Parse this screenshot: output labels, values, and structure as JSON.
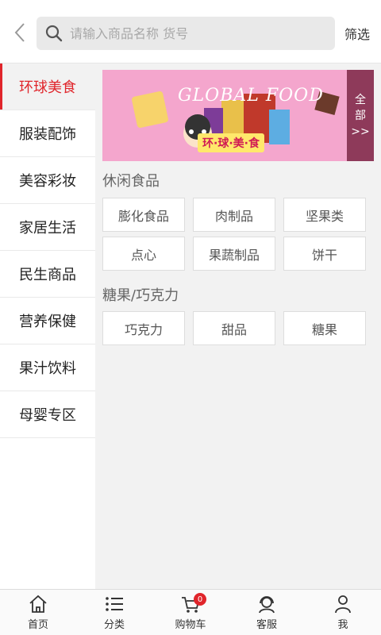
{
  "header": {
    "search_placeholder": "请输入商品名称 货号",
    "filter_label": "筛选"
  },
  "sidebar": {
    "items": [
      {
        "label": "环球美食"
      },
      {
        "label": "服装配饰"
      },
      {
        "label": "美容彩妆"
      },
      {
        "label": "家居生活"
      },
      {
        "label": "民生商品"
      },
      {
        "label": "营养保健"
      },
      {
        "label": "果汁饮料"
      },
      {
        "label": "母婴专区"
      }
    ]
  },
  "banner": {
    "title": "GLOBAL FOOD",
    "tag": "环·球·美·食",
    "all_line1": "全",
    "all_line2": "部",
    "all_arrow": ">>"
  },
  "sections": [
    {
      "title": "休闲食品",
      "items": [
        "膨化食品",
        "肉制品",
        "坚果类",
        "点心",
        "果蔬制品",
        "饼干"
      ]
    },
    {
      "title": "糖果/巧克力",
      "items": [
        "巧克力",
        "甜品",
        "糖果"
      ]
    }
  ],
  "bottom_nav": {
    "home": "首页",
    "category": "分类",
    "cart": "购物车",
    "cart_badge": "0",
    "service": "客服",
    "me": "我"
  },
  "colors": {
    "accent": "#e0252b",
    "banner_bg": "#f4a6cd",
    "banner_all_bg": "#8e3a5a"
  }
}
